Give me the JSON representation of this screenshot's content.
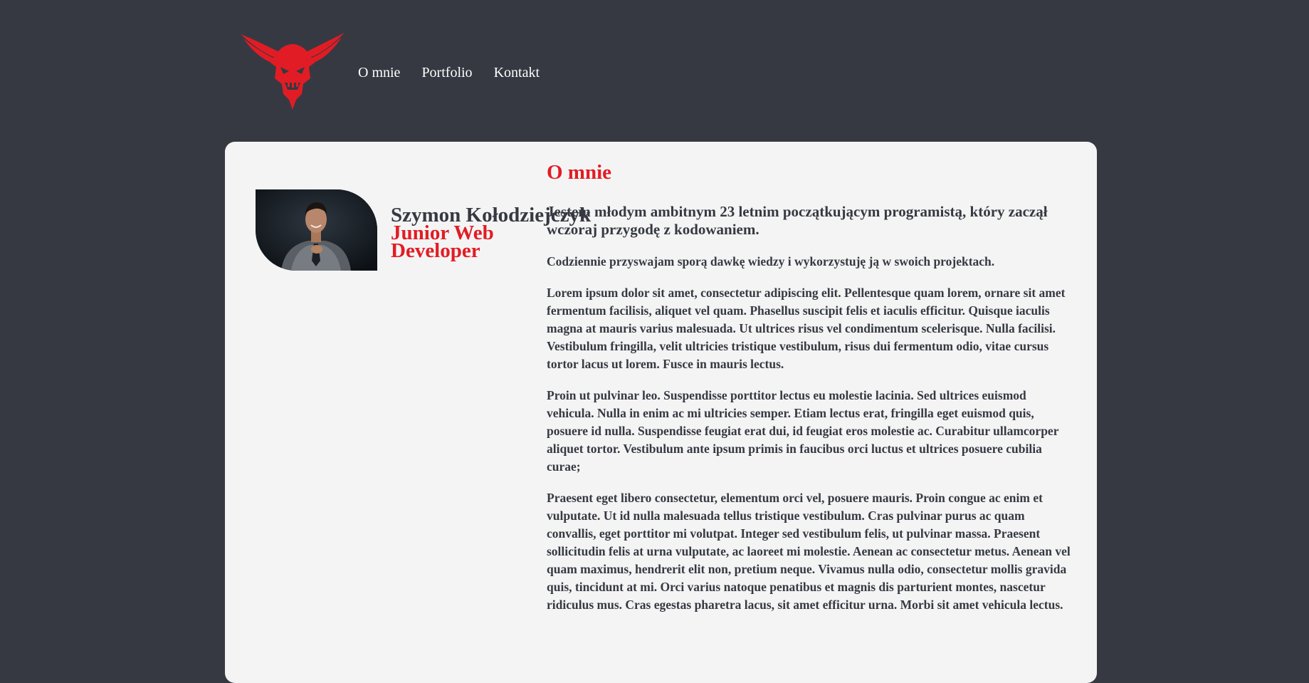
{
  "header": {
    "logo_icon": "demon-skull-logo-icon",
    "nav": [
      {
        "label": "O mnie"
      },
      {
        "label": "Portfolio"
      },
      {
        "label": "Kontakt"
      }
    ]
  },
  "profile": {
    "name": "Szymon Kołodziejczyk",
    "role": "Junior Web Developer"
  },
  "about": {
    "title": "O mnie",
    "lead": "Jestem młodym ambitnym 23 letnim początkującym programistą, który zaczął wczoraj przygodę z kodowaniem.",
    "paragraphs": [
      "Codziennie przyswajam sporą dawkę wiedzy i wykorzystuję ją w swoich projektach.",
      "Lorem ipsum dolor sit amet, consectetur adipiscing elit. Pellentesque quam lorem, ornare sit amet fermentum facilisis, aliquet vel quam. Phasellus suscipit felis et iaculis efficitur. Quisque iaculis magna at mauris varius malesuada. Ut ultrices risus vel condimentum scelerisque. Nulla facilisi. Vestibulum fringilla, velit ultricies tristique vestibulum, risus dui fermentum odio, vitae cursus tortor lacus ut lorem. Fusce in mauris lectus.",
      "Proin ut pulvinar leo. Suspendisse porttitor lectus eu molestie lacinia. Sed ultrices euismod vehicula. Nulla in enim ac mi ultricies semper. Etiam lectus erat, fringilla eget euismod quis, posuere id nulla. Suspendisse feugiat erat dui, id feugiat eros molestie ac. Curabitur ullamcorper aliquet tortor. Vestibulum ante ipsum primis in faucibus orci luctus et ultrices posuere cubilia curae;",
      "Praesent eget libero consectetur, elementum orci vel, posuere mauris. Proin congue ac enim et vulputate. Ut id nulla malesuada tellus tristique vestibulum. Cras pulvinar purus ac quam convallis, eget porttitor mi volutpat. Integer sed vestibulum felis, ut pulvinar massa. Praesent sollicitudin felis at urna vulputate, ac laoreet mi molestie. Aenean ac consectetur metus. Aenean vel quam maximus, hendrerit elit non, pretium neque. Vivamus nulla odio, consectetur mollis gravida quis, tincidunt at mi. Orci varius natoque penatibus et magnis dis parturient montes, nascetur ridiculus mus. Cras egestas pharetra lacus, sit amet efficitur urna. Morbi sit amet vehicula lectus."
    ]
  },
  "colors": {
    "background": "#363942",
    "card": "#f4f4f4",
    "accent": "#e21c24",
    "text": "#363942",
    "nav_text": "#ffffff"
  }
}
